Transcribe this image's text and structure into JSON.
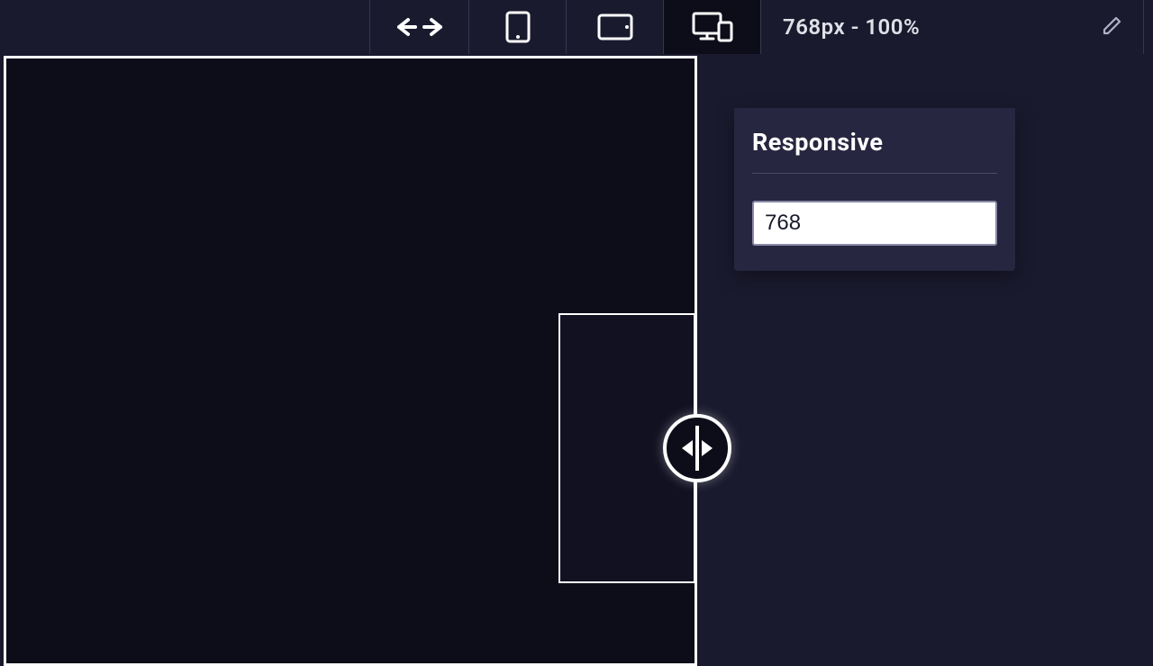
{
  "toolbar": {
    "status": "768px - 100%",
    "icons": {
      "arrows": "arrows-left-right-icon",
      "phone": "phone-portrait-icon",
      "tablet": "tablet-landscape-icon",
      "responsive": "responsive-devices-icon",
      "edit": "pencil-icon"
    }
  },
  "dropdown": {
    "title": "Responsive",
    "width_value": "768"
  },
  "drag_handle": {
    "name": "resize-handle"
  }
}
